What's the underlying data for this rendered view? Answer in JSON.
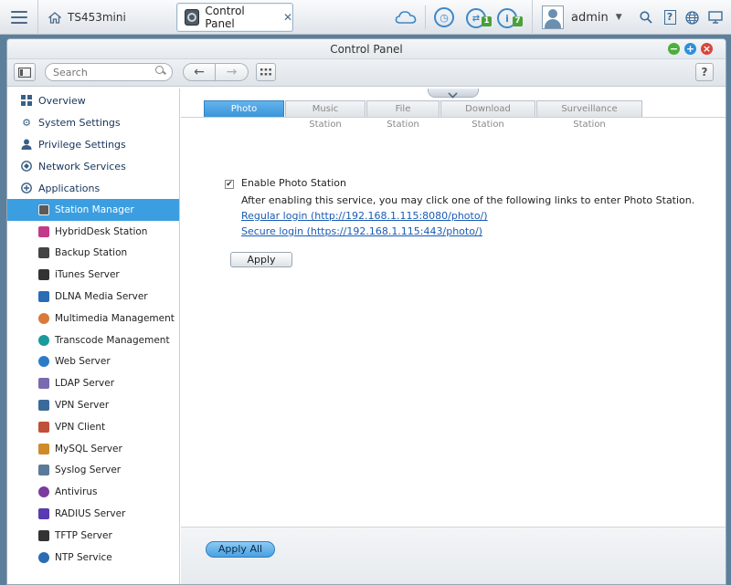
{
  "topbar": {
    "home_tab_label": "TS453mini",
    "app_tab_label": "Control Panel",
    "app_tab_close": "✕",
    "badge_backup": "1",
    "badge_notifications": "7",
    "username": "admin",
    "icons": [
      "menu-icon",
      "home-icon",
      "control-panel-icon",
      "cloud-icon",
      "clock-icon",
      "backup-status-icon",
      "info-icon",
      "avatar",
      "search-icon",
      "help-icon",
      "globe-icon",
      "display-icon"
    ]
  },
  "window": {
    "title": "Control Panel",
    "controls": {
      "minimize": "−",
      "maximize": "+",
      "close": "×"
    },
    "colors": {
      "minimize": "#4cae3c",
      "maximize": "#2f8fd8",
      "close": "#d9453a"
    }
  },
  "toolbar": {
    "search_placeholder": "Search",
    "help_label": "?"
  },
  "sidebar": {
    "categories": [
      {
        "label": "Overview",
        "icon": "overview-icon"
      },
      {
        "label": "System Settings",
        "icon": "system-settings-icon"
      },
      {
        "label": "Privilege Settings",
        "icon": "privilege-icon"
      },
      {
        "label": "Network Services",
        "icon": "network-services-icon"
      },
      {
        "label": "Applications",
        "icon": "applications-icon"
      }
    ],
    "items": [
      {
        "label": "Station Manager",
        "icon": "station-manager-icon",
        "active": true,
        "color": "#5a5a5a"
      },
      {
        "label": "HybridDesk Station",
        "icon": "hybriddesk-icon",
        "color": "#c33a8a"
      },
      {
        "label": "Backup Station",
        "icon": "backup-station-icon",
        "color": "#444444"
      },
      {
        "label": "iTunes Server",
        "icon": "itunes-icon",
        "color": "#333333"
      },
      {
        "label": "DLNA Media Server",
        "icon": "dlna-icon",
        "color": "#2a6cb5"
      },
      {
        "label": "Multimedia Management",
        "icon": "multimedia-icon",
        "color": "#d87a3a"
      },
      {
        "label": "Transcode Management",
        "icon": "transcode-icon",
        "color": "#1a9a9a"
      },
      {
        "label": "Web Server",
        "icon": "web-server-icon",
        "color": "#2a7cc8"
      },
      {
        "label": "LDAP Server",
        "icon": "ldap-icon",
        "color": "#7a6ab0"
      },
      {
        "label": "VPN Server",
        "icon": "vpn-server-icon",
        "color": "#3a6a9a"
      },
      {
        "label": "VPN Client",
        "icon": "vpn-client-icon",
        "color": "#c0503a"
      },
      {
        "label": "MySQL Server",
        "icon": "mysql-icon",
        "color": "#d08a2a"
      },
      {
        "label": "Syslog Server",
        "icon": "syslog-icon",
        "color": "#5a7a9a"
      },
      {
        "label": "Antivirus",
        "icon": "antivirus-icon",
        "color": "#7a3aa0"
      },
      {
        "label": "RADIUS Server",
        "icon": "radius-icon",
        "color": "#5a3ab0"
      },
      {
        "label": "TFTP Server",
        "icon": "tftp-icon",
        "color": "#333333"
      },
      {
        "label": "NTP Service",
        "icon": "ntp-icon",
        "color": "#2a6cb5"
      }
    ]
  },
  "content": {
    "tabs": [
      "Photo Station",
      "Music Station",
      "File Station",
      "Download Station",
      "Surveillance Station"
    ],
    "active_tab": "Photo Station",
    "enable_label": "Enable Photo Station",
    "enable_checked": true,
    "description": "After enabling this service, you may click one of the following links to enter Photo Station.",
    "regular_login": "Regular login (http://192.168.1.115:8080/photo/)",
    "secure_login": "Secure login (https://192.168.1.115:443/photo/)",
    "apply_label": "Apply",
    "apply_all_label": "Apply All"
  }
}
